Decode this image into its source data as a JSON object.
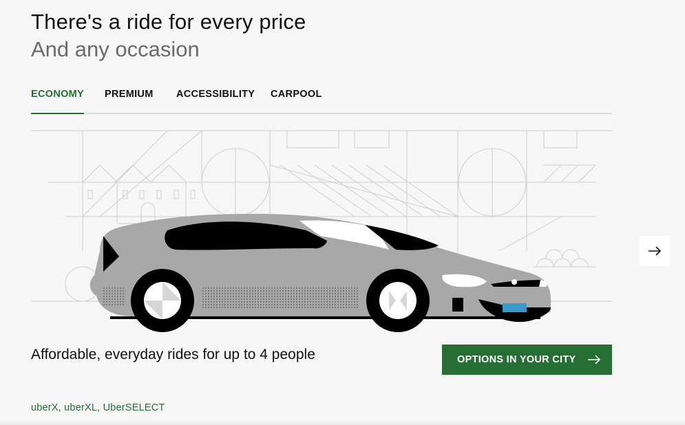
{
  "header": {
    "title": "There's a ride for every price",
    "subtitle": "And any occasion"
  },
  "tabs": [
    {
      "label": "ECONOMY",
      "active": true
    },
    {
      "label": "PREMIUM",
      "active": false
    },
    {
      "label": "ACCESSIBILITY",
      "active": false
    },
    {
      "label": "CARPOOL",
      "active": false
    }
  ],
  "hero": {
    "illustration": "economy-car-illustration",
    "next_icon": "arrow-right-icon"
  },
  "content": {
    "description": "Affordable, everyday rides for up to 4 people",
    "cta_label": "OPTIONS IN YOUR CITY",
    "cta_icon": "arrow-right-icon",
    "products": [
      "uberX",
      "uberXL",
      "UberSELECT"
    ],
    "separator": ","
  },
  "colors": {
    "accent": "#276e35",
    "background": "#f6f6f6",
    "car_body": "#a8a8a8",
    "line_art": "#cfcfcf",
    "plate": "#3a9ac9"
  }
}
